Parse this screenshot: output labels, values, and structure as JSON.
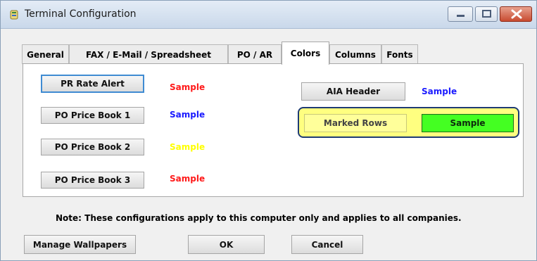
{
  "window": {
    "title": "Terminal Configuration",
    "icons": {
      "app": "app-icon",
      "minimize": "minimize-icon",
      "maximize": "maximize-icon",
      "close": "close-icon"
    }
  },
  "tabs": [
    {
      "label": "General",
      "active": false
    },
    {
      "label": "FAX / E-Mail / Spreadsheet",
      "active": false
    },
    {
      "label": "PO / AR",
      "active": false
    },
    {
      "label": "Colors",
      "active": true
    },
    {
      "label": "Columns",
      "active": false
    },
    {
      "label": "Fonts",
      "active": false
    }
  ],
  "colors_panel": {
    "left_rows": [
      {
        "button": "PR Rate Alert",
        "sample": "Sample",
        "sample_color": "#ff1a1a",
        "focused": true
      },
      {
        "button": "PO Price Book 1",
        "sample": "Sample",
        "sample_color": "#1a1aff"
      },
      {
        "button": "PO Price Book 2",
        "sample": "Sample",
        "sample_color": "#ffff00"
      },
      {
        "button": "PO Price Book 3",
        "sample": "Sample",
        "sample_color": "#ff1a1a"
      }
    ],
    "aia_header": {
      "button": "AIA Header",
      "sample": "Sample",
      "sample_color": "#1a1aff"
    },
    "marked_rows": {
      "button": "Marked Rows",
      "sample": "Sample",
      "group_bg": "#ffff80",
      "sample_bg": "#44ff22"
    }
  },
  "note": "Note: These configurations apply to this computer only and applies to all companies.",
  "footer": {
    "manage_wallpapers": "Manage Wallpapers",
    "ok": "OK",
    "cancel": "Cancel"
  }
}
